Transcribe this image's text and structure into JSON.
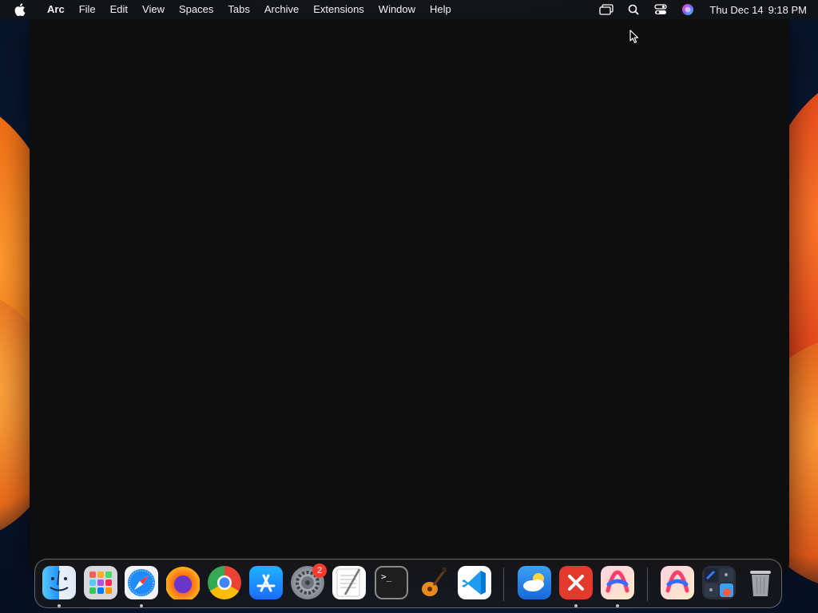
{
  "menubar": {
    "app_name": "Arc",
    "menus": [
      "File",
      "Edit",
      "View",
      "Spaces",
      "Tabs",
      "Archive",
      "Extensions",
      "Window",
      "Help"
    ],
    "status_icons": [
      "screen-mirroring-icon",
      "spotlight-search-icon",
      "control-center-icon",
      "siri-icon"
    ],
    "clock": {
      "date": "Thu Dec 14",
      "time": "9:18 PM"
    }
  },
  "window": {
    "app": "Arc",
    "background": "#0e0e0e"
  },
  "dock": {
    "items": [
      {
        "name": "Finder",
        "icon": "finder-icon",
        "running": true
      },
      {
        "name": "Launchpad",
        "icon": "launchpad-icon",
        "running": false
      },
      {
        "name": "Safari",
        "icon": "safari-icon",
        "running": true
      },
      {
        "name": "Firefox",
        "icon": "firefox-icon",
        "running": false
      },
      {
        "name": "Google Chrome",
        "icon": "chrome-icon",
        "running": false
      },
      {
        "name": "App Store",
        "icon": "app-store-icon",
        "running": false
      },
      {
        "name": "System Settings",
        "icon": "system-settings-icon",
        "running": false,
        "badge": "2"
      },
      {
        "name": "TextEdit",
        "icon": "textedit-icon",
        "running": false
      },
      {
        "name": "Terminal",
        "icon": "terminal-icon",
        "running": false
      },
      {
        "name": "GarageBand",
        "icon": "garageband-icon",
        "running": false
      },
      {
        "name": "Visual Studio Code",
        "icon": "vscode-icon",
        "running": false
      },
      {
        "name": "Weather",
        "icon": "weather-icon",
        "running": false
      },
      {
        "name": "Microsoft Remote Desktop",
        "icon": "remote-desktop-icon",
        "running": true
      },
      {
        "name": "Arc",
        "icon": "arc-icon",
        "running": true
      },
      {
        "name": "Arc",
        "icon": "arc-icon",
        "running": false
      },
      {
        "name": "Downloads stack",
        "icon": "stack-icon",
        "running": false
      },
      {
        "name": "Trash",
        "icon": "trash-icon",
        "running": false
      }
    ],
    "settings_badge": "2"
  },
  "terminal_glyph": ">_",
  "colors": {
    "menubar": "#141416",
    "accent_orange": "#f06a14",
    "badge": "#ff3b30"
  }
}
